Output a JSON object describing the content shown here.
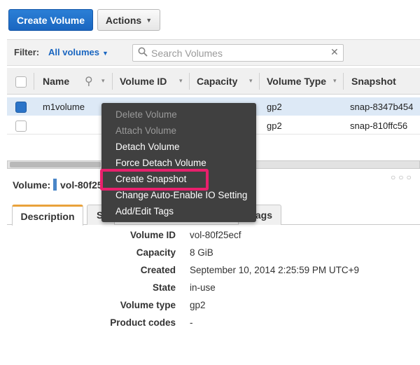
{
  "toolbar": {
    "create_label": "Create Volume",
    "actions_label": "Actions",
    "caret": "▼"
  },
  "filter": {
    "label": "Filter:",
    "selected": "All volumes",
    "caret": "▼",
    "search_placeholder": "Search Volumes",
    "clear": "✕"
  },
  "table": {
    "headers": [
      "Name",
      "Volume ID",
      "Capacity",
      "Volume Type",
      "Snapshot"
    ],
    "filter_glyph": "⚲",
    "sort_glyph": "▾",
    "rows": [
      {
        "name": "m1volume",
        "volume_type": "gp2",
        "snapshot": "snap-8347b454",
        "selected": true
      },
      {
        "name": "",
        "volume_type": "gp2",
        "snapshot": "snap-810ffc56",
        "selected": false
      }
    ]
  },
  "detail": {
    "volume_label": "Volume:",
    "volume_id_short": "vol-80f25",
    "dots": "○○○",
    "tabs": [
      {
        "label": "Description",
        "active": true
      },
      {
        "label": "S",
        "active": false
      },
      {
        "label": "ags",
        "active": false
      }
    ],
    "fields": [
      {
        "label": "Volume ID",
        "value": "vol-80f25ecf"
      },
      {
        "label": "Capacity",
        "value": "8 GiB"
      },
      {
        "label": "Created",
        "value": "September 10, 2014 2:25:59 PM UTC+9"
      },
      {
        "label": "State",
        "value": "in-use"
      },
      {
        "label": "Volume type",
        "value": "gp2"
      },
      {
        "label": "Product codes",
        "value": "-"
      }
    ]
  },
  "context_menu": {
    "items": [
      {
        "label": "Delete Volume",
        "enabled": false
      },
      {
        "label": "Attach Volume",
        "enabled": false
      },
      {
        "label": "Detach Volume",
        "enabled": true
      },
      {
        "label": "Force Detach Volume",
        "enabled": true
      },
      {
        "label": "Create Snapshot",
        "enabled": true,
        "highlighted": true
      },
      {
        "label": "Change Auto-Enable IO Setting",
        "enabled": true
      },
      {
        "label": "Add/Edit Tags",
        "enabled": true
      }
    ]
  },
  "colors": {
    "primary": "#1a66c0",
    "highlight": "#e8206c",
    "menu_bg": "#404040",
    "selected_row": "#dde9f6",
    "tab_accent": "#e9a23b"
  }
}
